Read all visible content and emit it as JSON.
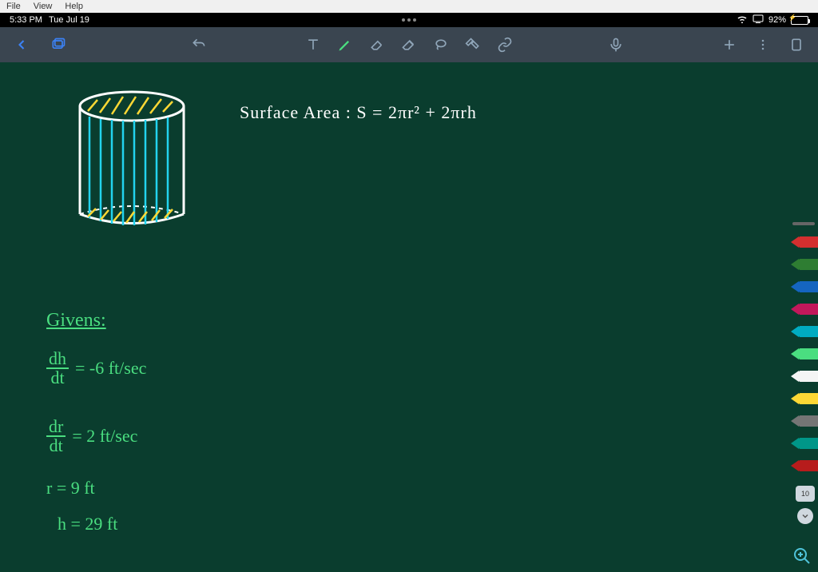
{
  "menu": {
    "items": [
      "File",
      "View",
      "Help"
    ]
  },
  "status": {
    "time": "5:33 PM",
    "date": "Tue Jul 19",
    "battery_pct": "92%"
  },
  "toolbar": {
    "tools": [
      "text",
      "pen",
      "eraser",
      "eraser-alt",
      "lasso",
      "cut",
      "link"
    ]
  },
  "palette": {
    "colors": [
      "#d32f2f",
      "#2e7d32",
      "#1565c0",
      "#c2185b",
      "#00acc1",
      "#4ade80",
      "#f5f5f5",
      "#fdd835",
      "#757575",
      "#009688",
      "#b71c1c"
    ]
  },
  "page": {
    "number": "10"
  },
  "content": {
    "formula": "Surface Area :  S = 2πr² + 2πrh",
    "givens_label": "Givens:",
    "dhdt_num": "dh",
    "dhdt_den": "dt",
    "dhdt_val": "= -6  ft/sec",
    "drdt_num": "dr",
    "drdt_den": "dt",
    "drdt_val": "=  2 ft/sec",
    "r_val": "r = 9 ft",
    "h_val": "h = 29 ft"
  }
}
